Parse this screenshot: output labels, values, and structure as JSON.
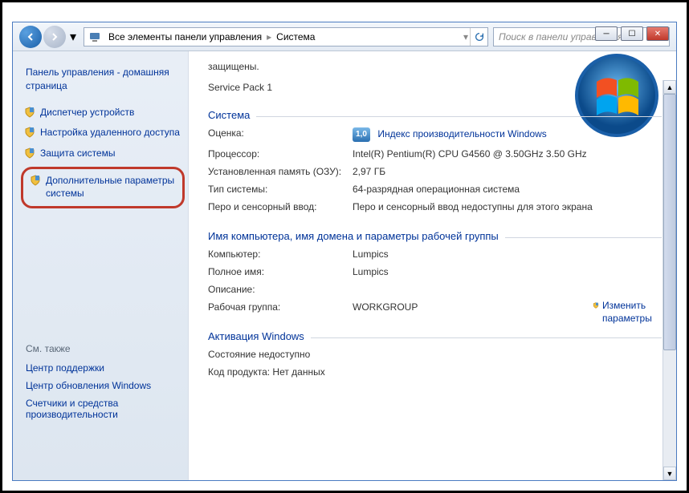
{
  "breadcrumb": {
    "seg1": "Все элементы панели управления",
    "seg2": "Система"
  },
  "search": {
    "placeholder": "Поиск в панели управления"
  },
  "sidebar": {
    "cp_home": "Панель управления - домашняя страница",
    "links": {
      "device_manager": "Диспетчер устройств",
      "remote": "Настройка удаленного доступа",
      "protection": "Защита системы",
      "advanced": "Дополнительные параметры системы"
    }
  },
  "see_also": {
    "head": "См. также",
    "links": {
      "action_center": "Центр поддержки",
      "windows_update": "Центр обновления Windows",
      "perf": "Счетчики и средства производительности"
    }
  },
  "top": {
    "line1": "защищены.",
    "line2": "Service Pack 1"
  },
  "sections": {
    "system": "Система",
    "computer_name": "Имя компьютера, имя домена и параметры рабочей группы",
    "activation": "Активация Windows"
  },
  "system": {
    "rating_label": "Оценка:",
    "rating_value": "1,0",
    "rating_link": "Индекс производительности Windows",
    "cpu_label": "Процессор:",
    "cpu_value": "Intel(R) Pentium(R) CPU G4560 @ 3.50GHz   3.50 GHz",
    "ram_label": "Установленная память (ОЗУ):",
    "ram_value": "2,97 ГБ",
    "type_label": "Тип системы:",
    "type_value": "64-разрядная операционная система",
    "pen_label": "Перо и сенсорный ввод:",
    "pen_value": "Перо и сенсорный ввод недоступны для этого экрана"
  },
  "name": {
    "change_link": "Изменить параметры",
    "computer_label": "Компьютер:",
    "computer_value": "Lumpics",
    "full_label": "Полное имя:",
    "full_value": "Lumpics",
    "desc_label": "Описание:",
    "desc_value": "",
    "workgroup_label": "Рабочая группа:",
    "workgroup_value": "WORKGROUP"
  },
  "activation": {
    "status_label": "Состояние недоступно",
    "product_label": "Код продукта: Нет данных"
  }
}
